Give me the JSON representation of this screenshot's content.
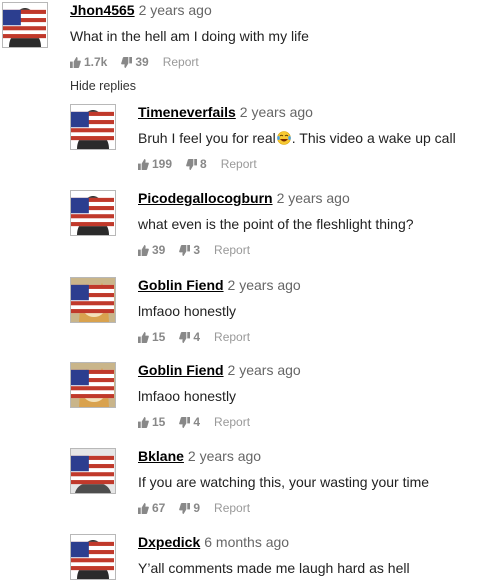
{
  "comments": [
    {
      "user": "Jhon4565",
      "time": "2 years ago",
      "text": "What in the hell am I doing with my life",
      "likes": "1.7k",
      "dislikes": "39",
      "report": "Report",
      "avatar": "silhouette"
    },
    {
      "user": "Timeneverfails",
      "time": "2 years ago",
      "text_before": "Bruh I feel you for real",
      "text_after": ". This video a wake up call",
      "likes": "199",
      "dislikes": "8",
      "report": "Report",
      "avatar": "silhouette"
    },
    {
      "user": "Picodegallocogburn",
      "time": "2 years ago",
      "text": "what even is the point of the fleshlight thing?",
      "likes": "39",
      "dislikes": "3",
      "report": "Report",
      "avatar": "silhouette"
    },
    {
      "user": "Goblin Fiend",
      "time": "2 years ago",
      "text": "lmfaoo honestly",
      "likes": "15",
      "dislikes": "4",
      "report": "Report",
      "avatar": "doge"
    },
    {
      "user": "Goblin Fiend",
      "time": "2 years ago",
      "text": "lmfaoo honestly",
      "likes": "15",
      "dislikes": "4",
      "report": "Report",
      "avatar": "doge"
    },
    {
      "user": "Bklane",
      "time": "2 years ago",
      "text": "If you are watching this, your wasting your time",
      "likes": "67",
      "dislikes": "9",
      "report": "Report",
      "avatar": "soldier"
    },
    {
      "user": "Dxpedick",
      "time": "6 months ago",
      "text": "Y’all comments made me laugh hard as hell",
      "likes": "",
      "dislikes": "",
      "report": "",
      "avatar": "silhouette"
    }
  ],
  "hide_replies": "Hide replies",
  "icons": {
    "like": "thumbs-up-icon",
    "dislike": "thumbs-down-icon",
    "flag": "us-flag-icon",
    "emoji": "laughing-emoji-icon"
  }
}
